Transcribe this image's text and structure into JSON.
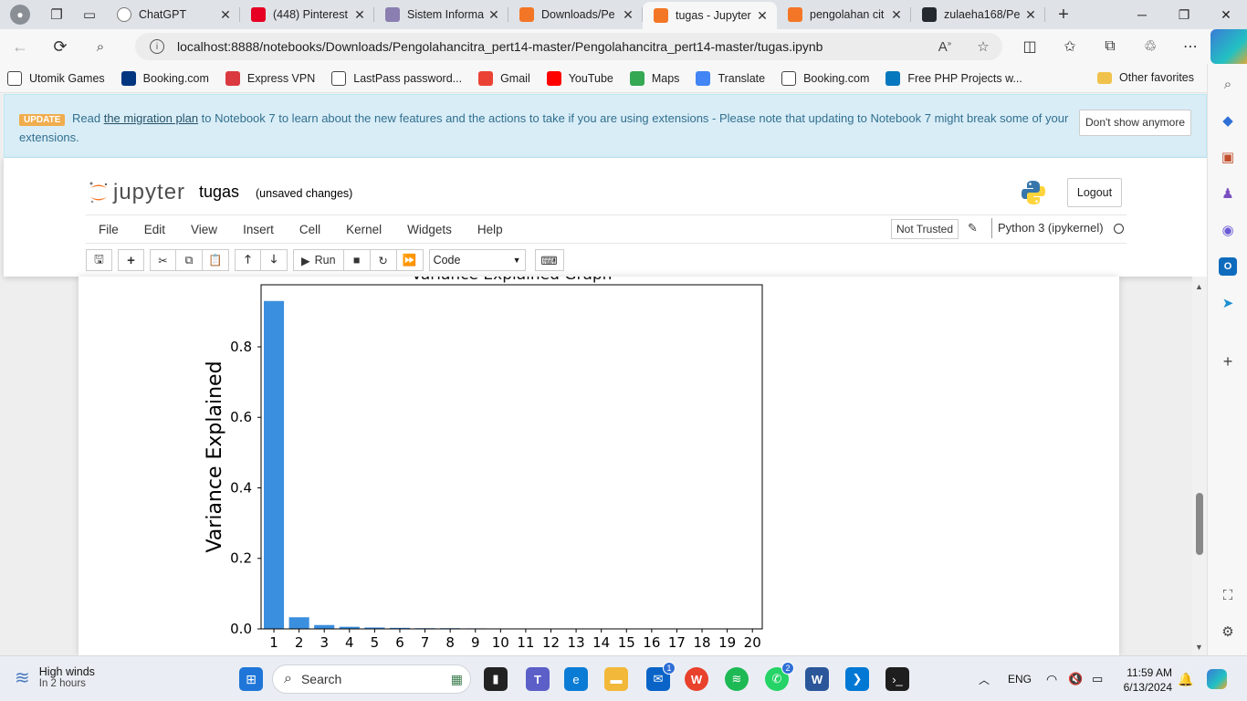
{
  "browser": {
    "tabs": [
      {
        "title": "ChatGPT",
        "color": "#ffffff",
        "icon": "chatgpt-icon"
      },
      {
        "title": "(448) Pinterest",
        "color": "#e60023",
        "icon": "pinterest-icon"
      },
      {
        "title": "Sistem Informa",
        "color": "#8a7fb0",
        "icon": "sistem-icon"
      },
      {
        "title": "Downloads/Pe",
        "color": "#f37626",
        "icon": "jupyter-icon"
      },
      {
        "title": "tugas - Jupyter",
        "color": "#f37626",
        "icon": "notebook-icon"
      },
      {
        "title": "pengolahan cit",
        "color": "#f37626",
        "icon": "notebook-icon"
      },
      {
        "title": "zulaeha168/Pe",
        "color": "#24292f",
        "icon": "github-icon"
      }
    ],
    "url": "localhost:8888/notebooks/Downloads/Pengolahancitra_pert14-master/Pengolahancitra_pert14-master/tugas.ipynb",
    "favorites": [
      {
        "label": "Utomik Games",
        "icon": "page-icon",
        "color": "#ffffff"
      },
      {
        "label": "Booking.com",
        "icon": "booking-icon",
        "color": "#003580"
      },
      {
        "label": "Express VPN",
        "icon": "vpn-icon",
        "color": "#da3940"
      },
      {
        "label": "LastPass password...",
        "icon": "page-icon",
        "color": "#ffffff"
      },
      {
        "label": "Gmail",
        "icon": "gmail-icon",
        "color": "#ea4335"
      },
      {
        "label": "YouTube",
        "icon": "youtube-icon",
        "color": "#ff0000"
      },
      {
        "label": "Maps",
        "icon": "maps-icon",
        "color": "#34a853"
      },
      {
        "label": "Translate",
        "icon": "translate-icon",
        "color": "#4285f4"
      },
      {
        "label": "Booking.com",
        "icon": "page-icon",
        "color": "#ffffff"
      },
      {
        "label": "Free PHP Projects w...",
        "icon": "drupal-icon",
        "color": "#0678be"
      }
    ],
    "other_favorites": "Other favorites"
  },
  "notebook": {
    "banner": {
      "badge": "UPDATE",
      "text_before": "Read",
      "link": "the migration plan",
      "text_after": "to Notebook 7 to learn about the new features and the actions to take if you are using extensions - Please note that updating to Notebook 7 might break some of your extensions.",
      "dismiss": "Don't show anymore"
    },
    "logo_text": "jupyter",
    "name": "tugas",
    "status": "(unsaved changes)",
    "logout": "Logout",
    "menu": [
      "File",
      "Edit",
      "View",
      "Insert",
      "Cell",
      "Kernel",
      "Widgets",
      "Help"
    ],
    "trusted": "Not Trusted",
    "kernel": "Python 3 (ipykernel)",
    "run_label": "Run",
    "cell_type": "Code"
  },
  "chart_data": {
    "type": "bar",
    "title": "Variance Explained Graph",
    "ylabel": "Variance Explained",
    "xlabel": "",
    "categories": [
      "1",
      "2",
      "3",
      "4",
      "5",
      "6",
      "7",
      "8",
      "9",
      "10",
      "11",
      "12",
      "13",
      "14",
      "15",
      "16",
      "17",
      "18",
      "19",
      "20"
    ],
    "values": [
      0.93,
      0.033,
      0.011,
      0.006,
      0.004,
      0.003,
      0.002,
      0.002,
      0.0015,
      0.0012,
      0.001,
      0.0008,
      0.0006,
      0.0004,
      0.0003,
      0.0002,
      0.0002,
      0.0001,
      0.0001,
      0.0001
    ],
    "yticks": [
      "0.0",
      "0.2",
      "0.4",
      "0.6",
      "0.8"
    ],
    "ytick_values": [
      0,
      0.2,
      0.4,
      0.6,
      0.8
    ],
    "ylim": [
      0,
      0.976
    ],
    "bar_color": "#3a8fdf",
    "grid": false
  },
  "taskbar": {
    "weather_title": "High winds",
    "weather_sub": "In 2 hours",
    "search": "Search",
    "language": "ENG",
    "time": "11:59 AM",
    "date": "6/13/2024",
    "mail_badge": "1",
    "whatsapp_badge": "2"
  }
}
